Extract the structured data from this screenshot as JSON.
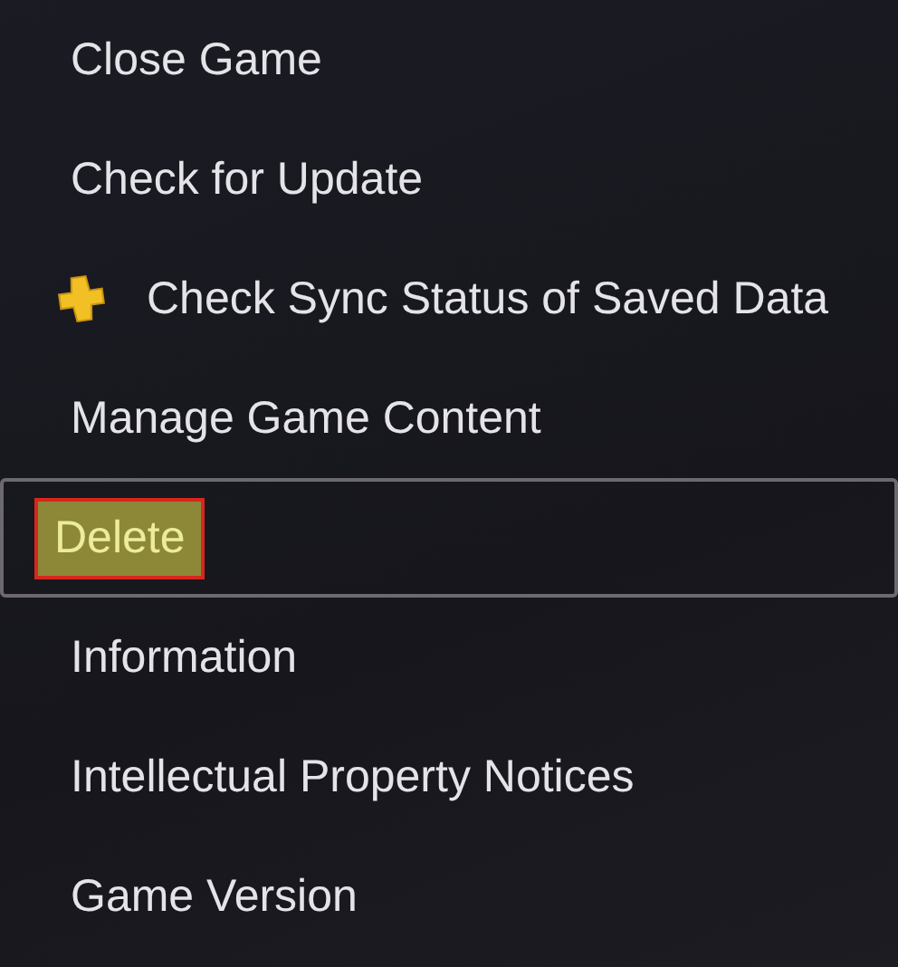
{
  "menu": {
    "items": [
      {
        "label": "Close Game",
        "kind": "plain",
        "selected": false
      },
      {
        "label": "Check for Update",
        "kind": "plain",
        "selected": false
      },
      {
        "label": "Check Sync Status of Saved Data",
        "kind": "plus",
        "selected": false
      },
      {
        "label": "Manage Game Content",
        "kind": "plain",
        "selected": false
      },
      {
        "label": "Delete",
        "kind": "plain",
        "selected": true
      },
      {
        "label": "Information",
        "kind": "plain",
        "selected": false
      },
      {
        "label": "Intellectual Property Notices",
        "kind": "plain",
        "selected": false
      },
      {
        "label": "Game Version",
        "kind": "plain",
        "selected": false
      }
    ]
  }
}
